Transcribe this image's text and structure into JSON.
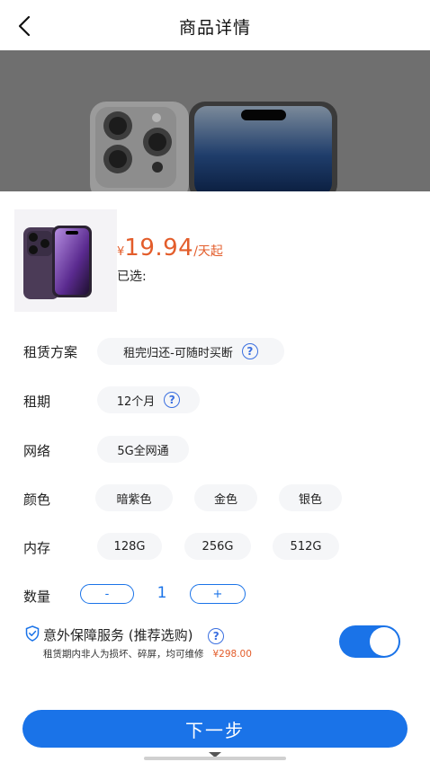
{
  "header": {
    "title": "商品详情",
    "back_icon": "chevron-left-icon"
  },
  "product": {
    "price_currency": "¥",
    "price_value": "19.94",
    "price_unit": "/天起",
    "selected_label": "已选:"
  },
  "options": {
    "plan": {
      "label": "租赁方案",
      "value": "租完归还-可随时买断",
      "help_icon": "question-icon"
    },
    "term": {
      "label": "租期",
      "value": "12个月",
      "help_icon": "question-icon"
    },
    "network": {
      "label": "网络",
      "value": "5G全网通"
    },
    "color": {
      "label": "颜色",
      "items": [
        "暗紫色",
        "金色",
        "银色"
      ]
    },
    "storage": {
      "label": "内存",
      "items": [
        "128G",
        "256G",
        "512G"
      ]
    },
    "quantity": {
      "label": "数量",
      "minus": "-",
      "value": "1",
      "plus": "+"
    }
  },
  "insurance": {
    "title": "意外保障服务 (推荐选购)",
    "subtitle": "租赁期内非人为损坏、碎屏，均可维修",
    "price": "¥298.00",
    "enabled": true,
    "shield_icon": "shield-check-icon",
    "help_icon": "question-icon"
  },
  "footer": {
    "next_label": "下一步"
  },
  "colors": {
    "accent": "#1a73e8",
    "price": "#e35d2b",
    "chip_bg": "#f5f6f8"
  }
}
